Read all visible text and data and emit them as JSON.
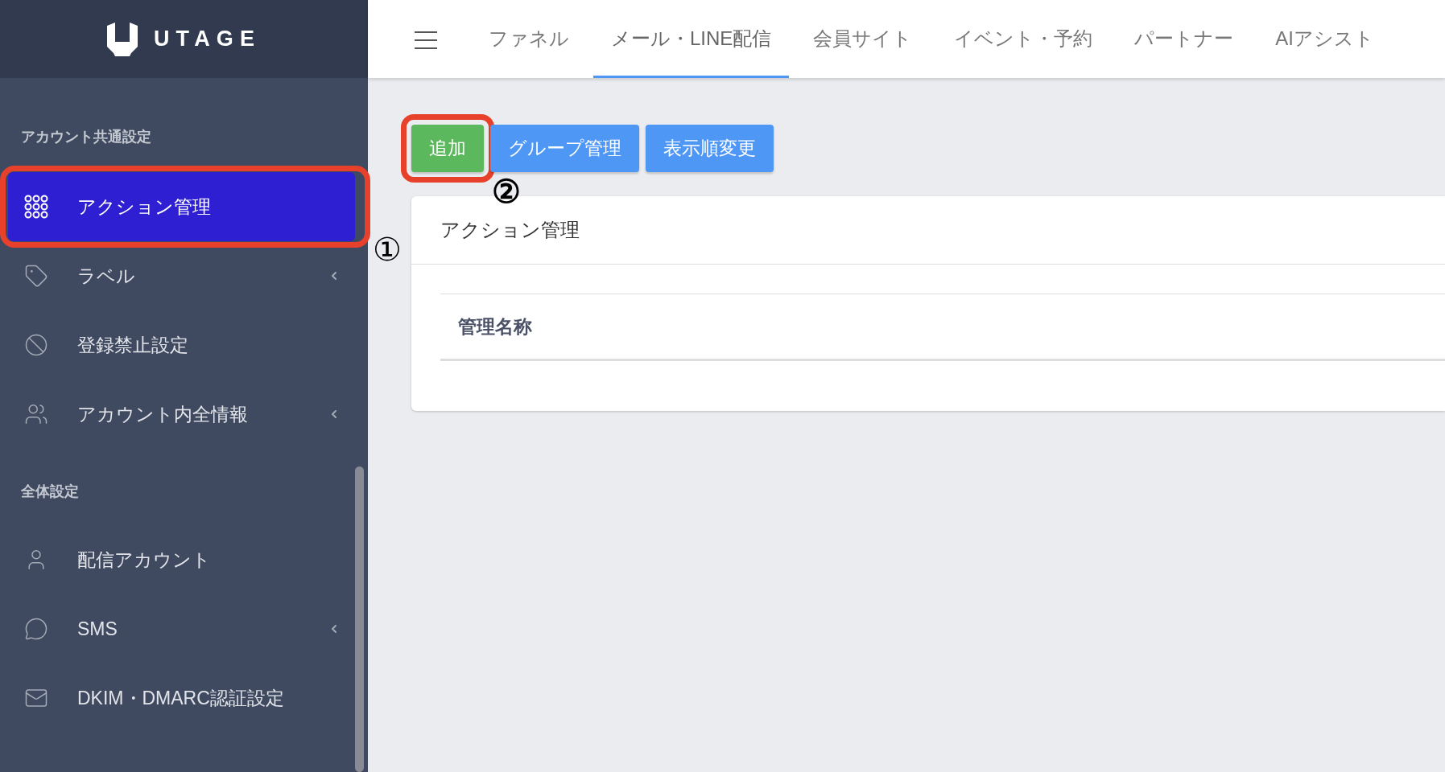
{
  "logo": {
    "text": "UTAGE"
  },
  "header": {
    "tabs": [
      {
        "label": "ファネル",
        "selected": false
      },
      {
        "label": "メール・LINE配信",
        "selected": true
      },
      {
        "label": "会員サイト",
        "selected": false
      },
      {
        "label": "イベント・予約",
        "selected": false
      },
      {
        "label": "パートナー",
        "selected": false
      },
      {
        "label": "AIアシスト",
        "selected": false
      }
    ]
  },
  "sidebar": {
    "sections": [
      {
        "title": "アカウント共通設定",
        "items": [
          {
            "label": "アクション管理",
            "selected": true,
            "expandable": false,
            "highlighted": true
          },
          {
            "label": "ラベル",
            "selected": false,
            "expandable": true,
            "highlighted": false
          },
          {
            "label": "登録禁止設定",
            "selected": false,
            "expandable": false,
            "highlighted": false
          },
          {
            "label": "アカウント内全情報",
            "selected": false,
            "expandable": true,
            "highlighted": false
          }
        ]
      },
      {
        "title": "全体設定",
        "items": [
          {
            "label": "配信アカウント",
            "selected": false,
            "expandable": false,
            "highlighted": false
          },
          {
            "label": "SMS",
            "selected": false,
            "expandable": true,
            "highlighted": false
          },
          {
            "label": "DKIM・DMARC認証設定",
            "selected": false,
            "expandable": false,
            "highlighted": false
          }
        ]
      }
    ]
  },
  "toolbar": {
    "buttons": [
      {
        "label": "追加",
        "kind": "success",
        "highlighted": true
      },
      {
        "label": "グループ管理",
        "kind": "primary",
        "highlighted": false
      },
      {
        "label": "表示順変更",
        "kind": "primary",
        "highlighted": false
      }
    ]
  },
  "card": {
    "title": "アクション管理",
    "table": {
      "columns": [
        "管理名称"
      ]
    }
  },
  "annotations": [
    {
      "label": "①"
    },
    {
      "label": "②"
    }
  ]
}
